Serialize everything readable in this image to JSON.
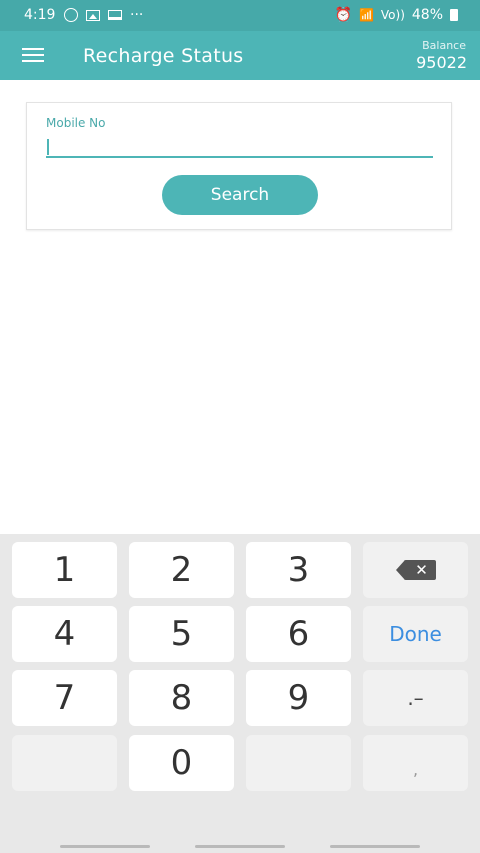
{
  "status_bar": {
    "time": "4:19",
    "dots": "···",
    "network": "Vo))",
    "battery": "48%"
  },
  "app_bar": {
    "title": "Recharge Status",
    "balance_label": "Balance",
    "balance_value": "95022"
  },
  "form": {
    "mobile_label": "Mobile No",
    "mobile_value": "",
    "search_label": "Search"
  },
  "keyboard": {
    "keys": [
      "1",
      "2",
      "3",
      "4",
      "5",
      "6",
      "7",
      "8",
      "9",
      "0"
    ],
    "done_label": "Done",
    "symbol_key": ".–",
    "comma_key": ","
  },
  "colors": {
    "primary": "#4db5b6",
    "status_bar": "#46a9a9",
    "done": "#3c8ee0"
  }
}
